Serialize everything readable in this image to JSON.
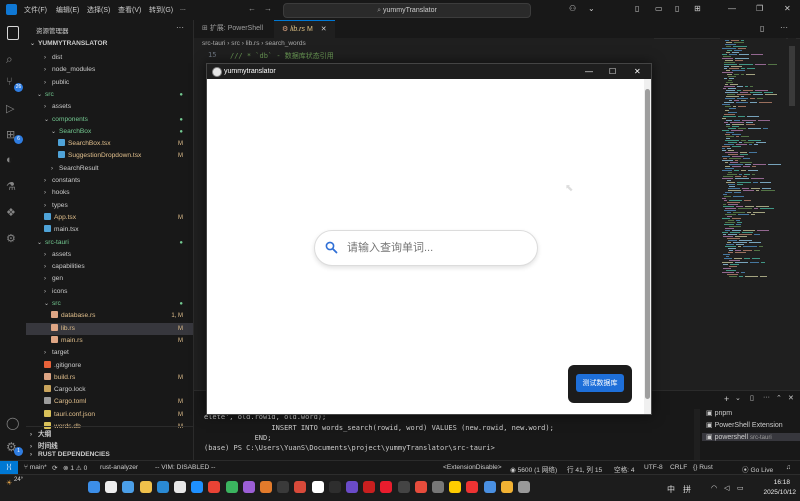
{
  "titlebar": {
    "menus": [
      "文件(F)",
      "编辑(E)",
      "选择(S)",
      "查看(V)",
      "转到(G)",
      "..."
    ],
    "command_center": "yummyTranslator"
  },
  "activity": {
    "scm_badge": "26",
    "ext_badge": "6",
    "account_badge": "1"
  },
  "explorer": {
    "header": "资源管理器",
    "root": "YUMMYTRANSLATOR",
    "rows": [
      {
        "label": "dist",
        "type": "folder"
      },
      {
        "label": "node_modules",
        "type": "folder"
      },
      {
        "label": "public",
        "type": "folder"
      },
      {
        "label": "src",
        "type": "folder-open",
        "status": "●"
      },
      {
        "label": "assets",
        "type": "folder"
      },
      {
        "label": "components",
        "type": "folder-open",
        "status": "●"
      },
      {
        "label": "SearchBox",
        "type": "folder-open",
        "status": "●"
      },
      {
        "label": "SearchBox.tsx",
        "type": "tsx",
        "status": "M"
      },
      {
        "label": "SuggestionDropdown.tsx",
        "type": "tsx",
        "status": "M"
      },
      {
        "label": "SearchResult",
        "type": "folder"
      },
      {
        "label": "constants",
        "type": "folder"
      },
      {
        "label": "hooks",
        "type": "folder"
      },
      {
        "label": "types",
        "type": "folder"
      },
      {
        "label": "App.tsx",
        "type": "tsx",
        "status": "M"
      },
      {
        "label": "main.tsx",
        "type": "tsx"
      },
      {
        "label": "src-tauri",
        "type": "folder-open",
        "status": "●"
      },
      {
        "label": "assets",
        "type": "folder"
      },
      {
        "label": "capabilities",
        "type": "folder"
      },
      {
        "label": "gen",
        "type": "folder"
      },
      {
        "label": "icons",
        "type": "folder"
      },
      {
        "label": "src",
        "type": "folder-open",
        "status": "●"
      },
      {
        "label": "database.rs",
        "type": "rs",
        "status": "1, M"
      },
      {
        "label": "lib.rs",
        "type": "rs",
        "status": "M"
      },
      {
        "label": "main.rs",
        "type": "rs",
        "status": "M"
      },
      {
        "label": "target",
        "type": "folder"
      },
      {
        "label": ".gitignore",
        "type": "git"
      },
      {
        "label": "build.rs",
        "type": "rs",
        "status": "M"
      },
      {
        "label": "Cargo.lock",
        "type": "lock"
      },
      {
        "label": "Cargo.toml",
        "type": "toml",
        "status": "M"
      },
      {
        "label": "tauri.conf.json",
        "type": "json",
        "status": "M"
      },
      {
        "label": "words.db",
        "type": "db",
        "status": "M"
      }
    ],
    "sections": [
      "大纲",
      "时间线",
      "RUST DEPENDENCIES"
    ]
  },
  "editor": {
    "tabs": [
      {
        "label": "扩展: PowerShell",
        "active": false
      },
      {
        "label": "lib.rs",
        "active": true,
        "status": "M"
      }
    ],
    "breadcrumb": [
      "src-tauri",
      "src",
      "lib.rs",
      "search_words"
    ],
    "visible_line_no": "15",
    "visible_line": "/// * `db` - 数据库状态引用"
  },
  "terminal": {
    "lines": [
      "elete', old.rowid, old.word);",
      "                INSERT INTO words_search(rowid, word) VALUES (new.rowid, new.word);",
      "            END;",
      "(base) PS C:\\Users\\YuanS\\Documents\\project\\yummyTranslator\\src-tauri>"
    ],
    "sessions": [
      "pnpm",
      "PowerShell Extension",
      "powershell"
    ],
    "active_session_suffix": "src-tauri"
  },
  "statusbar": {
    "branch": "main*",
    "errors": "1",
    "warnings": "0",
    "analyzer": "rust-analyzer",
    "vim": "-- VIM: DISABLED --",
    "extension": "<ExtensionDisable>",
    "pid": "5600 (1 网络)",
    "position": "行 41, 列 15",
    "spaces": "空格: 4",
    "encoding": "UTF-8",
    "eol": "CRLF",
    "language": "Rust",
    "golive": "Go Live"
  },
  "taskbar": {
    "weather": "24°",
    "input_lang": "中",
    "ime": "拼",
    "time": "16:18",
    "date": "2025/10/12"
  },
  "app": {
    "title": "yummytranslator",
    "search_placeholder": "请输入查询单词...",
    "test_button": "测试数据库"
  }
}
